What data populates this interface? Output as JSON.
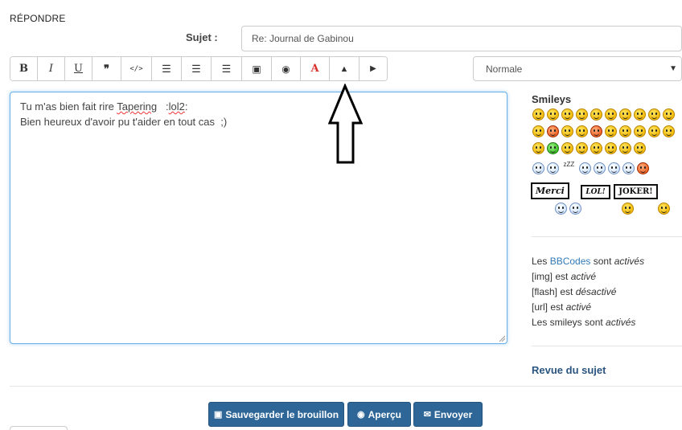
{
  "page": {
    "heading": "RÉPONDRE"
  },
  "subject": {
    "label": "Sujet :",
    "value": "Re: Journal de Gabinou"
  },
  "toolbar": {
    "buttons": [
      {
        "icon": "bold-icon",
        "glyph": "B",
        "color": "#333333"
      },
      {
        "icon": "italic-icon",
        "glyph": "I",
        "color": "#333333"
      },
      {
        "icon": "underline-icon",
        "glyph": "U",
        "color": "#333333"
      },
      {
        "icon": "quote-icon",
        "glyph": "❞",
        "color": "#333333"
      },
      {
        "icon": "code-icon",
        "glyph": "</>",
        "color": "#333333"
      },
      {
        "icon": "list-icon",
        "glyph": "☰",
        "color": "#333333"
      },
      {
        "icon": "bullet-list-icon",
        "glyph": "☰",
        "color": "#333333"
      },
      {
        "icon": "list-item-icon",
        "glyph": "☰",
        "color": "#333333"
      },
      {
        "icon": "image-icon",
        "glyph": "▣",
        "color": "#333333"
      },
      {
        "icon": "globe-icon",
        "glyph": "◉",
        "color": "#333333"
      },
      {
        "icon": "font-color-icon",
        "glyph": "A",
        "color": "#d9302b"
      },
      {
        "icon": "warning-icon",
        "glyph": "▲",
        "color": "#333333"
      },
      {
        "icon": "youtube-icon",
        "glyph": "▶",
        "color": "#333333"
      }
    ],
    "font_size": {
      "selected": "Normale"
    }
  },
  "editor": {
    "line1_prefix": "Tu m'as bien fait rire ",
    "line1_misspelled_1": "Tapering",
    "line1_middle": "   :",
    "line1_misspelled_2": "lol2",
    "line1_suffix": ":",
    "line2": "Bien heureux d'avoir pu t'aider en tout cas  ;)"
  },
  "smileys": {
    "title": "Smileys",
    "sign_merci": "Merci",
    "sign_lol": "LOL!",
    "sign_joker": "JOKER!",
    "zzz": "zZZ"
  },
  "bbcode_info": {
    "line1_pre": "Les ",
    "line1_link": "BBCodes",
    "line1_mid": " sont ",
    "line1_state": "activés",
    "line2_pre": "[img] est ",
    "line2_state": "activé",
    "line3_pre": "[flash] est ",
    "line3_state": "désactivé",
    "line4_pre": "[url] est ",
    "line4_state": "activé",
    "line5_pre": "Les smileys sont ",
    "line5_state": "activés"
  },
  "revue": "Revue du sujet",
  "actions": {
    "save_draft": "Sauvegarder le brouillon",
    "preview": "Aperçu",
    "send": "Envoyer"
  },
  "colors": {
    "primary_button": "#2e6697",
    "link": "#337ab7",
    "focus_border": "#66afe9"
  }
}
